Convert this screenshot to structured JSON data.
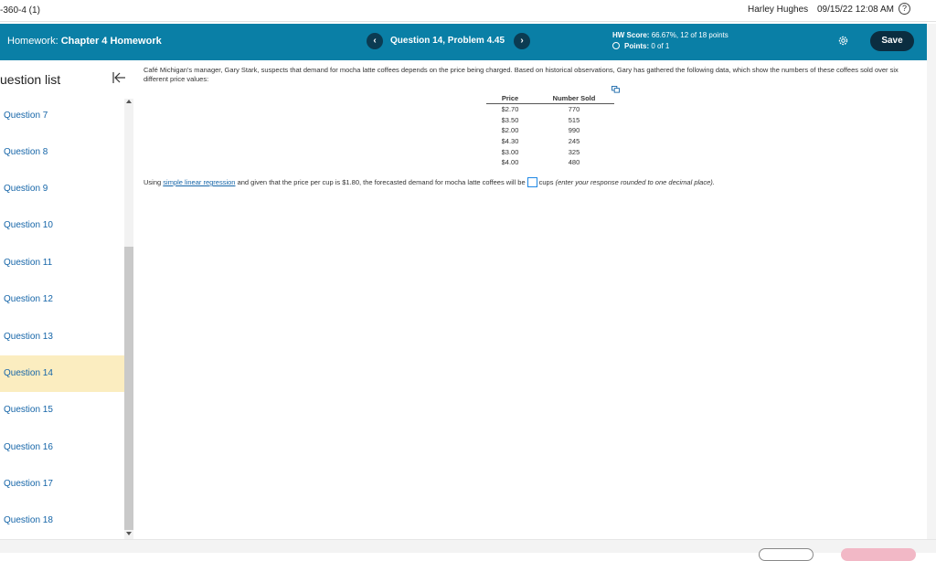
{
  "topbar": {
    "course": "-360-4 (1)",
    "user": "Harley Hughes",
    "datetime": "09/15/22 12:08 AM",
    "help_icon": "?"
  },
  "header": {
    "hw_prefix": "Homework:",
    "hw_name": "Chapter 4 Homework",
    "prev_icon": "‹",
    "next_icon": "›",
    "question_title": "Question 14, Problem 4.45",
    "hw_score_label": "HW Score:",
    "hw_score_value": "66.67%, 12 of 18 points",
    "points_label": "Points:",
    "points_value": "0 of 1",
    "save_label": "Save"
  },
  "sidebar": {
    "title": "uestion list",
    "items": [
      {
        "label": "Question 7",
        "active": false
      },
      {
        "label": "Question 8",
        "active": false
      },
      {
        "label": "Question 9",
        "active": false
      },
      {
        "label": "Question 10",
        "active": false
      },
      {
        "label": "Question 11",
        "active": false
      },
      {
        "label": "Question 12",
        "active": false
      },
      {
        "label": "Question 13",
        "active": false
      },
      {
        "label": "Question 14",
        "active": true
      },
      {
        "label": "Question 15",
        "active": false
      },
      {
        "label": "Question 16",
        "active": false
      },
      {
        "label": "Question 17",
        "active": false
      },
      {
        "label": "Question 18",
        "active": false
      }
    ]
  },
  "problem": {
    "intro": "Café Michigan's manager, Gary Stark, suspects that demand for mocha latte coffees depends on the price being charged.  Based on historical observations, Gary has gathered the following data, which show the numbers of these coffees sold over six different price values:",
    "table": {
      "headers": [
        "Price",
        "Number Sold"
      ],
      "rows": [
        [
          "$2.70",
          "770"
        ],
        [
          "$3.50",
          "515"
        ],
        [
          "$2.00",
          "990"
        ],
        [
          "$4.30",
          "245"
        ],
        [
          "$3.00",
          "325"
        ],
        [
          "$4.00",
          "480"
        ]
      ]
    },
    "question_pre": "Using",
    "question_link": "simple linear regression",
    "question_mid": "and given that the price per cup is $1.80, the forecasted demand for mocha latte coffees will be",
    "question_post": "cups",
    "question_hint": "(enter your response rounded to one decimal place).",
    "answer_value": ""
  },
  "colors": {
    "header_bg": "#0a7fa6",
    "nav_arrow_bg": "#0b3b52",
    "save_bg": "#0b2d40",
    "active_item_bg": "#fbedc0",
    "link": "#1565a8"
  }
}
